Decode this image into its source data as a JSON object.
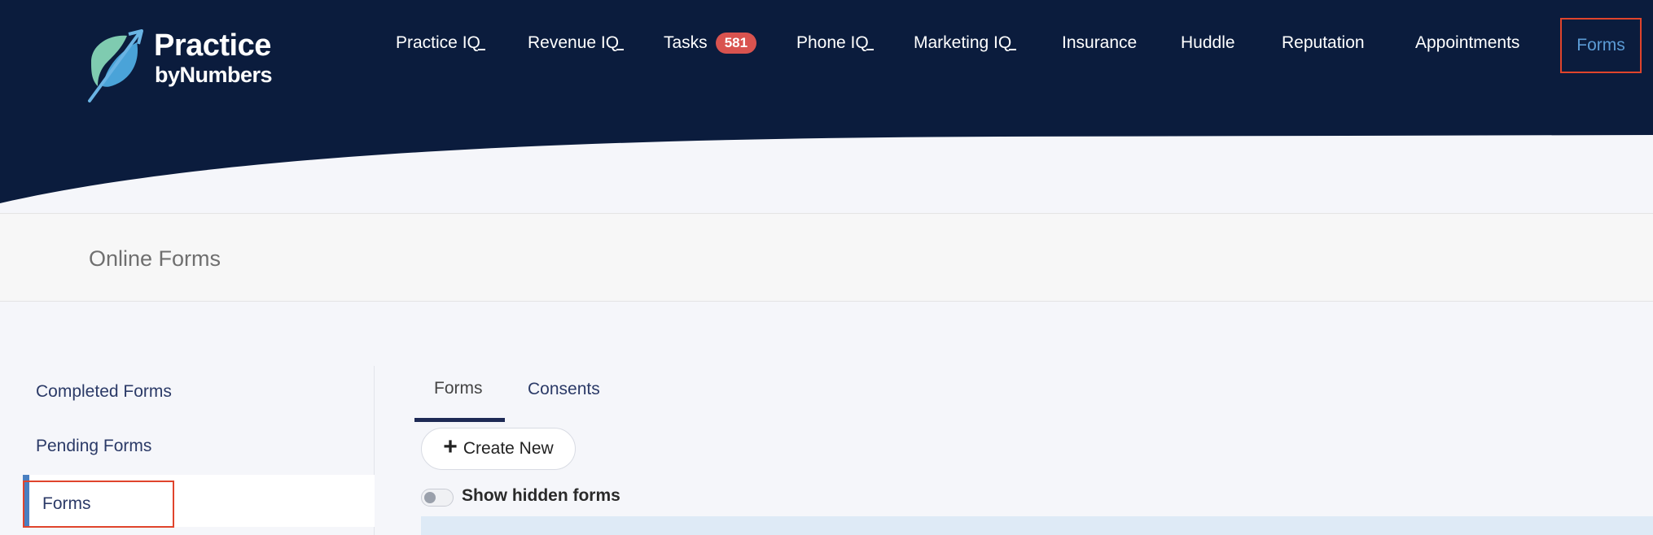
{
  "brand": {
    "name_line1": "Practice",
    "name_line2": "byNumbers",
    "header_color": "#0b1c3d"
  },
  "nav": {
    "items": [
      {
        "label": "Practice IQ",
        "icon": "iq-swoosh"
      },
      {
        "label": "Revenue IQ",
        "icon": "iq-swoosh"
      },
      {
        "label": "Tasks",
        "badge": "581"
      },
      {
        "label": "Phone IQ",
        "icon": "iq-swoosh"
      },
      {
        "label": "Marketing IQ",
        "icon": "iq-swoosh"
      },
      {
        "label": "Insurance"
      },
      {
        "label": "Huddle"
      },
      {
        "label": "Reputation"
      },
      {
        "label": "Appointments"
      },
      {
        "label": "Forms",
        "active": true
      }
    ],
    "active_color": "#5b9bd5",
    "highlight_color": "#e0442c"
  },
  "page": {
    "title": "Online Forms"
  },
  "sidebar": {
    "items": [
      {
        "label": "Completed Forms"
      },
      {
        "label": "Pending Forms"
      },
      {
        "label": "Forms",
        "active": true
      }
    ]
  },
  "main": {
    "tabs": [
      {
        "label": "Forms",
        "active": true
      },
      {
        "label": "Consents"
      }
    ],
    "create_button": "Create New",
    "show_hidden_label": "Show hidden forms",
    "show_hidden_checked": false
  }
}
